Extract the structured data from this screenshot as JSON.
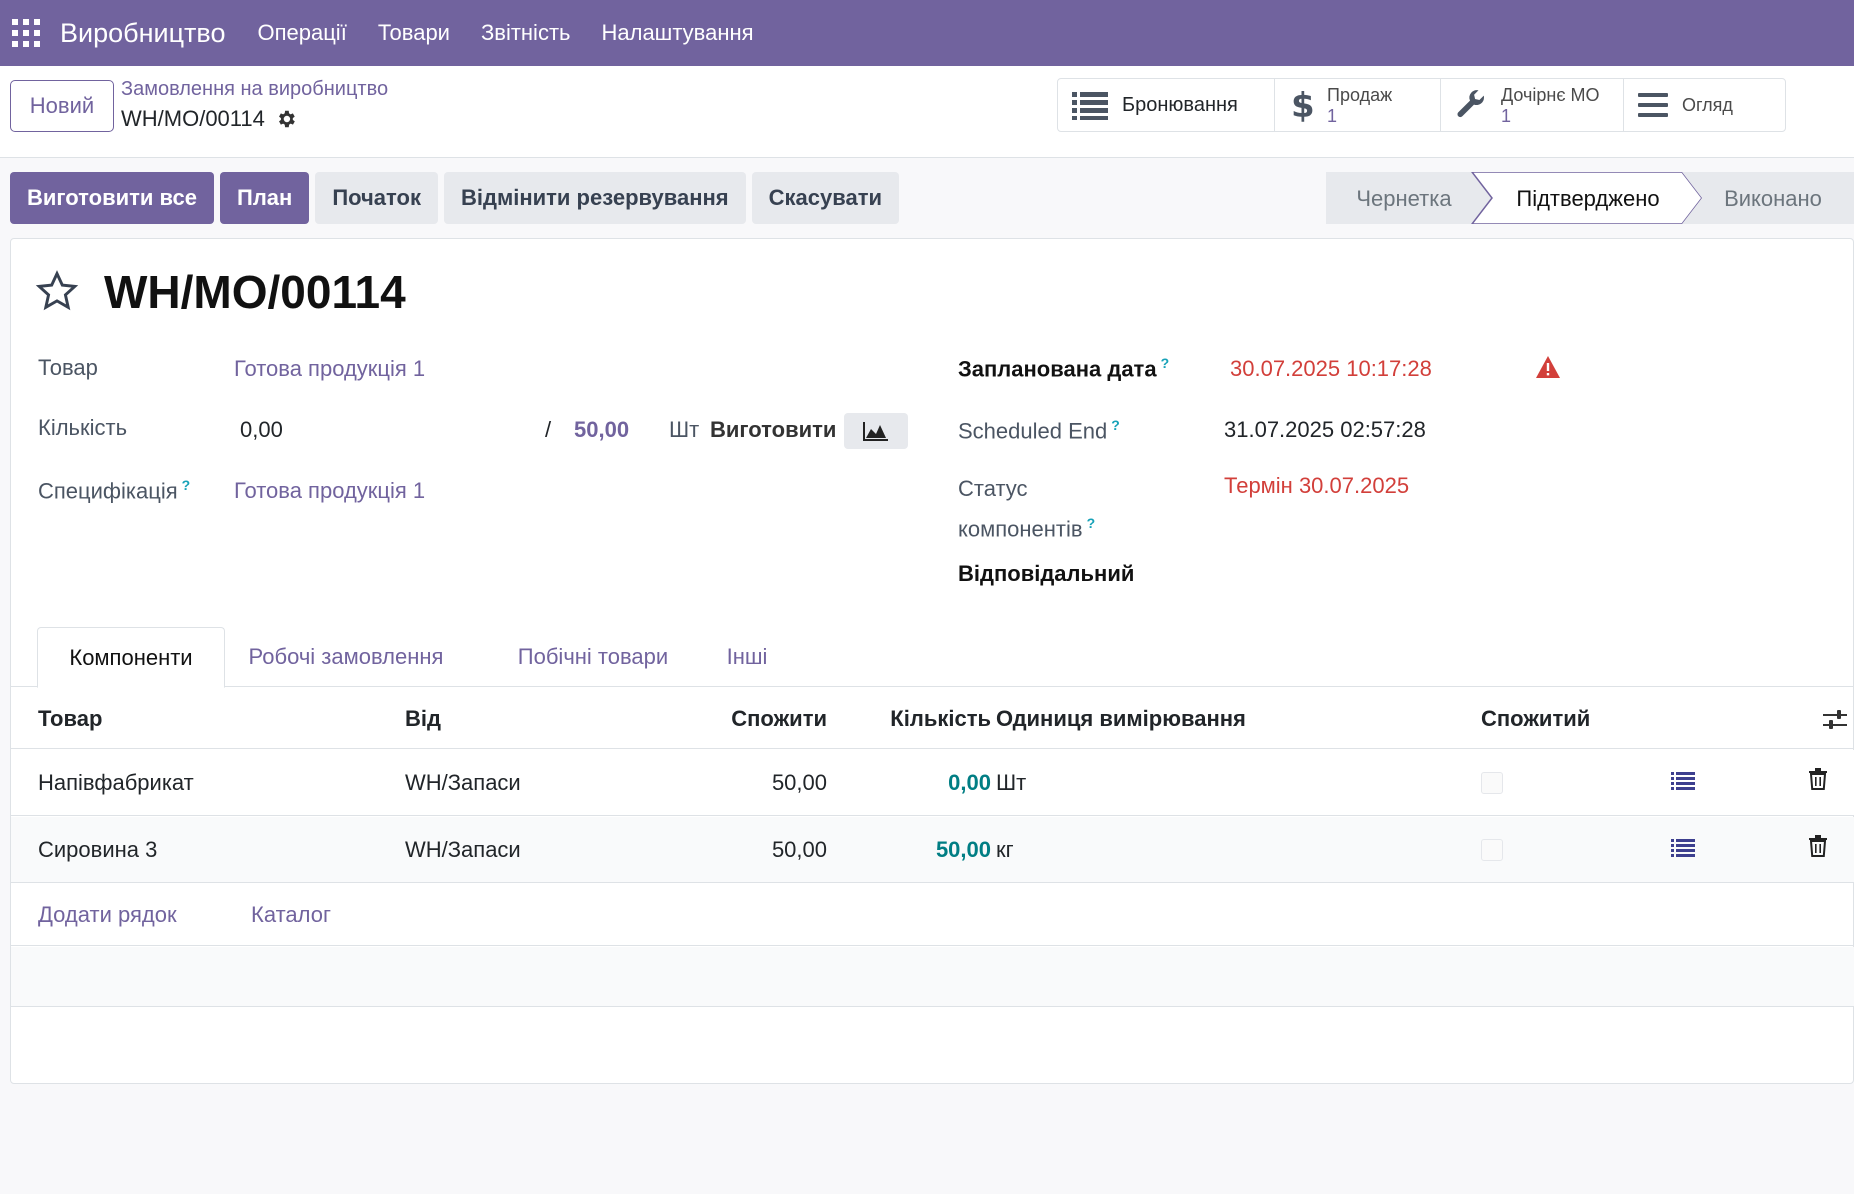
{
  "navbar": {
    "app_name": "Виробництво",
    "menu": [
      "Операції",
      "Товари",
      "Звітність",
      "Налаштування"
    ],
    "color": "#71639e"
  },
  "control_panel": {
    "new_label": "Новий",
    "breadcrumb_parent": "Замовлення на виробництво",
    "breadcrumb_current": "WH/MO/00114",
    "stat_buttons": [
      {
        "icon": "list-icon",
        "label": "Бронювання",
        "value": ""
      },
      {
        "icon": "dollar-icon",
        "label": "Продаж",
        "value": "1"
      },
      {
        "icon": "wrench-icon",
        "label": "Дочірнє МО",
        "value": "1"
      },
      {
        "icon": "bars-icon",
        "label": "Огляд",
        "value": ""
      }
    ]
  },
  "actions": {
    "produce_all": "Виготовити все",
    "plan": "План",
    "start": "Початок",
    "unreserve": "Відмінити резервування",
    "cancel": "Скасувати"
  },
  "status": {
    "steps": [
      "Чернетка",
      "Підтверджено",
      "Виконано"
    ],
    "active": "Підтверджено"
  },
  "form": {
    "title": "WH/MO/00114",
    "product_label": "Товар",
    "product_value": "Готова продукція 1",
    "quantity_label": "Кількість",
    "quantity_produced": "0,00",
    "quantity_separator": "/",
    "quantity_total": "50,00",
    "quantity_uom": "Шт",
    "produce_label": "Виготовити",
    "bom_label": "Специфікація",
    "bom_value": "Готова продукція 1",
    "scheduled_date_label": "Запланована дата",
    "scheduled_date_value": "30.07.2025 10:17:28",
    "scheduled_end_label": "Scheduled End",
    "scheduled_end_value": "31.07.2025 02:57:28",
    "components_status_label_1": "Статус",
    "components_status_label_2": "компонентів",
    "components_status_value": "Термін 30.07.2025",
    "responsible_label": "Відповідальний",
    "help_mark": "?"
  },
  "tabs": [
    "Компоненти",
    "Робочі замовлення",
    "Побічні товари",
    "Інші"
  ],
  "table": {
    "headers": [
      "Товар",
      "Від",
      "Спожити",
      "Кількість",
      "Одиниця вимірювання",
      "Спожитий"
    ],
    "rows": [
      {
        "product": "Напівфабрикат",
        "from": "WH/Запаси",
        "to_consume": "50,00",
        "quantity": "0,00",
        "uom": "Шт"
      },
      {
        "product": "Сировина 3",
        "from": "WH/Запаси",
        "to_consume": "50,00",
        "quantity": "50,00",
        "uom": "кг"
      }
    ],
    "add_line": "Додати рядок",
    "catalog": "Каталог"
  }
}
